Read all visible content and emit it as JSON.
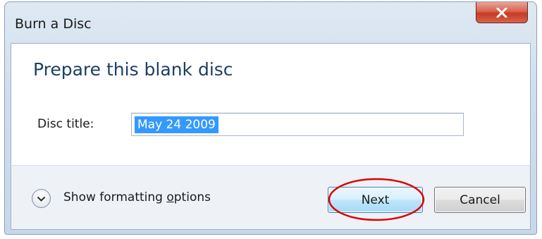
{
  "window": {
    "title": "Burn a Disc"
  },
  "main": {
    "heading": "Prepare this blank disc",
    "disc_title_label": "Disc title:",
    "disc_title_value": "May 24 2009"
  },
  "footer": {
    "expander_label_pre": "Show formatting ",
    "expander_label_access": "o",
    "expander_label_post": "ptions",
    "next_label": "Next",
    "cancel_label": "Cancel"
  },
  "icons": {
    "close": "close-icon",
    "expander": "chevron-down-icon"
  },
  "colors": {
    "heading": "#1e3f66",
    "selection": "#3399ff",
    "close_button": "#c73a22",
    "highlight_ring": "#e00000"
  }
}
